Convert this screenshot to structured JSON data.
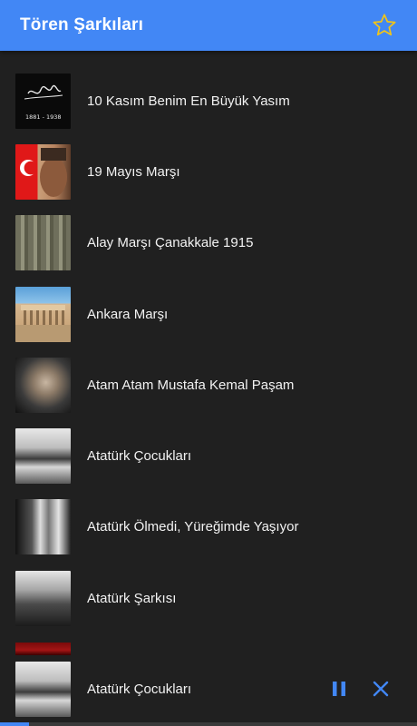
{
  "appbar": {
    "title": "Tören Şarkıları",
    "favorite_icon": "star-outline-icon",
    "accent_color": "#4287f5",
    "star_color": "#f0c419"
  },
  "songs": [
    {
      "title": "10 Kasım Benim En Büyük Yasım",
      "thumb": "signature-1881-1938"
    },
    {
      "title": "19 Mayıs Marşı",
      "thumb": "flag-portrait"
    },
    {
      "title": "Alay Marşı Çanakkale 1915",
      "thumb": "soldiers"
    },
    {
      "title": "Ankara Marşı",
      "thumb": "mausoleum"
    },
    {
      "title": "Atam Atam Mustafa Kemal Paşam",
      "thumb": "portrait"
    },
    {
      "title": "Atatürk Çocukları",
      "thumb": "children"
    },
    {
      "title": "Atatürk Ölmedi, Yüreğimde Yaşıyor",
      "thumb": "children-portrait"
    },
    {
      "title": "Atatürk Şarkısı",
      "thumb": "desk-portrait"
    }
  ],
  "thumb_text": {
    "years": "1881 - 1938"
  },
  "player": {
    "title": "Atatürk Çocukları",
    "pause_icon": "pause-icon",
    "close_icon": "close-icon",
    "progress": 0.07
  }
}
